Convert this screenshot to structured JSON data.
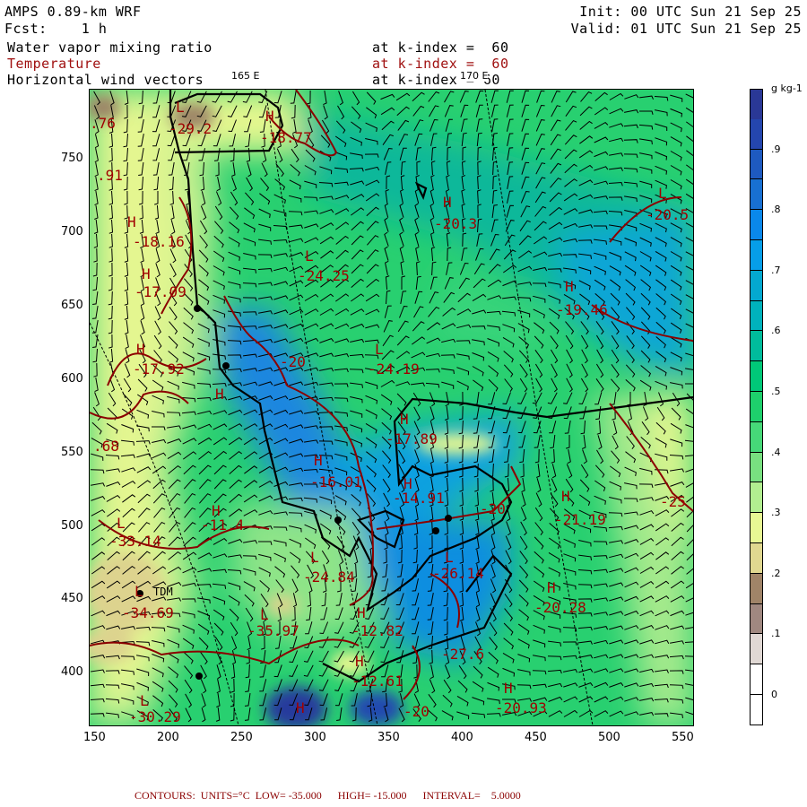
{
  "header": {
    "title": "AMPS 0.89-km WRF",
    "forecast": "Fcst:    1 h",
    "init": "Init: 00 UTC Sun 21 Sep 25",
    "valid": "Valid: 01 UTC Sun 21 Sep 25"
  },
  "fields": [
    {
      "name": "Water vapor mixing ratio",
      "level": "at k-index =  60"
    },
    {
      "name": "Temperature",
      "level": "at k-index =  60"
    },
    {
      "name": "Horizontal wind vectors",
      "level": "at k-index = 60"
    }
  ],
  "meridians": [
    "165 E",
    "170 E"
  ],
  "axes": {
    "x_ticks": [
      "150",
      "200",
      "250",
      "300",
      "350",
      "400",
      "450",
      "500",
      "550"
    ],
    "y_ticks": [
      "750",
      "700",
      "650",
      "600",
      "550",
      "500",
      "450",
      "400"
    ]
  },
  "colorbar": {
    "units": "g kg-1",
    "labels": [
      ".9",
      ".8",
      ".7",
      ".6",
      ".5",
      ".4",
      ".3",
      ".2",
      ".1",
      "0"
    ],
    "colors": [
      "#2a3896",
      "#2446ae",
      "#1e5ac0",
      "#1870d2",
      "#0a88ea",
      "#069ee8",
      "#04a8d0",
      "#00b2bc",
      "#00bc9c",
      "#00c878",
      "#1ed06c",
      "#46d878",
      "#78e080",
      "#b2ee90",
      "#e8f894",
      "#e0d890",
      "#a08468",
      "#a08880",
      "#e0d8d4",
      "#ffffff",
      "#ffffff"
    ]
  },
  "map": {
    "station": "TDM",
    "labels": [
      "L",
      "-29.2",
      "H",
      "-18.77",
      ".76",
      ".91",
      "H",
      "-18.16",
      "H",
      "-17.09",
      "H",
      "-17.92",
      "H",
      "L",
      "-24.25",
      "-20",
      "L",
      "-24.19",
      "H",
      "-20.3",
      "L",
      "-20.5",
      "H",
      "-19.46",
      "H",
      "-17.89",
      "H",
      "-16.01",
      "H",
      "-14.91",
      "-20",
      "H",
      "-21.19",
      "-25",
      ".68",
      "H",
      "-11.4",
      "L",
      "-33.14",
      "L",
      "-34.69",
      "L",
      "-24.84",
      "L",
      "-35.97",
      "H",
      "-12.82",
      "L",
      "-26.14",
      "H",
      "-20.28",
      "H",
      "-12.61",
      "-27.6",
      "H",
      "-20.93",
      "L",
      "-30.29",
      "H",
      "-20"
    ]
  },
  "footer": "CONTOURS:  UNITS=°C  LOW= -35.000      HIGH= -15.000      INTERVAL=    5.0000"
}
